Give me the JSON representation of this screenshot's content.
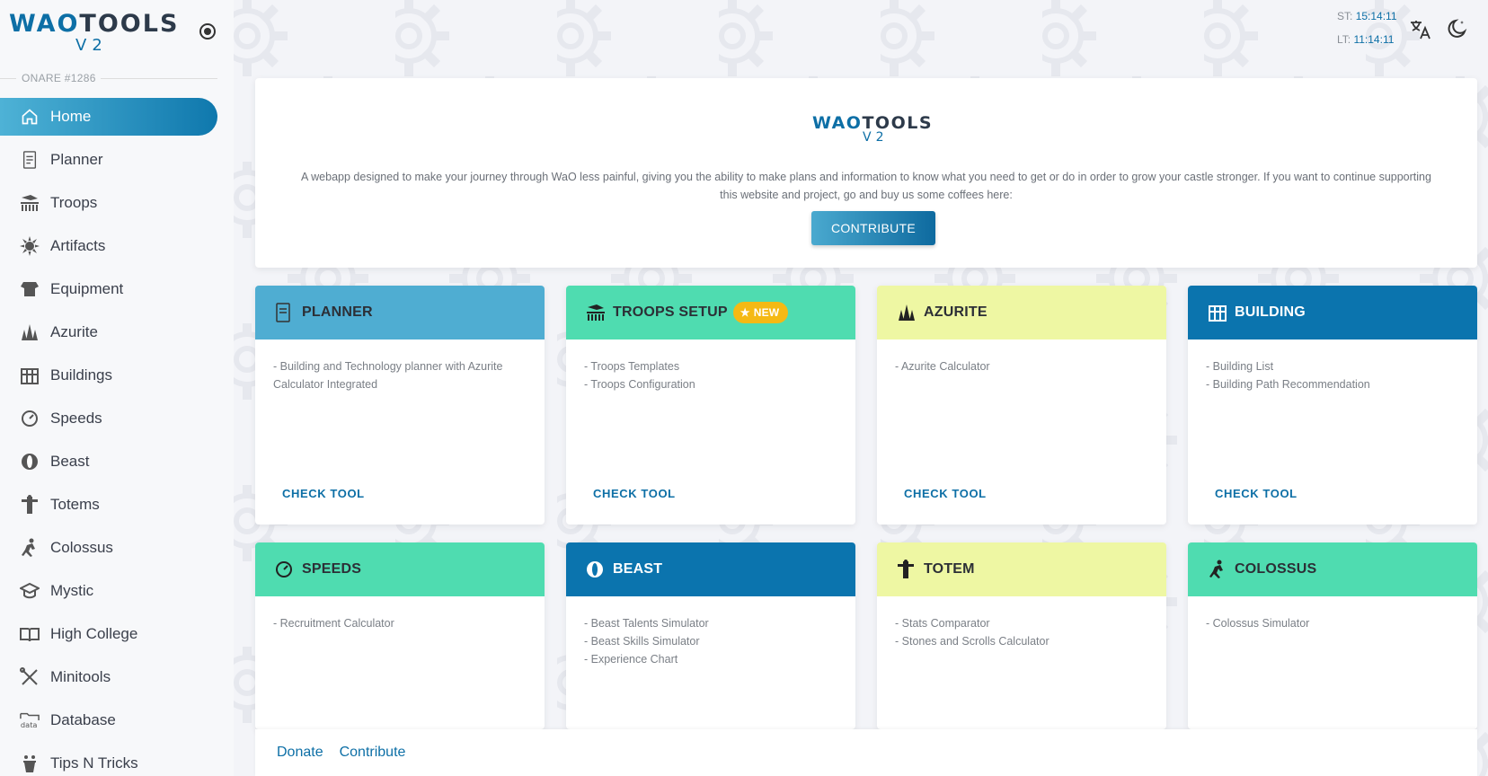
{
  "brand": {
    "logo_wao": "WAO",
    "logo_tools": "TOOLS",
    "logo_version": "V2"
  },
  "server": {
    "label": "ONARE #1286"
  },
  "sidebar": {
    "items": [
      {
        "label": "Home",
        "icon": "home-icon"
      },
      {
        "label": "Planner",
        "icon": "planner-icon"
      },
      {
        "label": "Troops",
        "icon": "troops-icon"
      },
      {
        "label": "Artifacts",
        "icon": "artifacts-icon"
      },
      {
        "label": "Equipment",
        "icon": "equipment-icon"
      },
      {
        "label": "Azurite",
        "icon": "azurite-icon"
      },
      {
        "label": "Buildings",
        "icon": "buildings-icon"
      },
      {
        "label": "Speeds",
        "icon": "speeds-icon"
      },
      {
        "label": "Beast",
        "icon": "beast-icon"
      },
      {
        "label": "Totems",
        "icon": "totems-icon"
      },
      {
        "label": "Colossus",
        "icon": "colossus-icon"
      },
      {
        "label": "Mystic",
        "icon": "mystic-icon"
      },
      {
        "label": "High College",
        "icon": "high-college-icon"
      },
      {
        "label": "Minitools",
        "icon": "minitools-icon"
      },
      {
        "label": "Database",
        "icon": "database-icon"
      },
      {
        "label": "Tips N Tricks",
        "icon": "tips-icon"
      }
    ]
  },
  "clock": {
    "st_label": "ST:",
    "st_value": "15:14:11",
    "lt_label": "LT:",
    "lt_value": "11:14:11"
  },
  "hero": {
    "description": "A webapp designed to make your journey through WaO less painful, giving you the ability to make plans and information to know what you need to get or do in order to grow your castle stronger. If you want to continue supporting this website and project, go and buy us some coffees here:",
    "button_label": "CONTRIBUTE"
  },
  "cards": [
    {
      "title": "PLANNER",
      "color": "#4fadd2",
      "lines": [
        "- Building and Technology planner with Azurite Calculator Integrated"
      ],
      "link": "CHECK TOOL"
    },
    {
      "title": "TROOPS SETUP",
      "color": "#4fdcb0",
      "badge": "NEW",
      "lines": [
        "- Troops Templates",
        "- Troops Configuration"
      ],
      "link": "CHECK TOOL"
    },
    {
      "title": "AZURITE",
      "color": "#eef7a3",
      "lines": [
        "- Azurite Calculator"
      ],
      "link": "CHECK TOOL"
    },
    {
      "title": "BUILDING",
      "color": "#0b74ae",
      "lines": [
        "- Building List",
        "- Building Path Recommendation"
      ],
      "link": "CHECK TOOL"
    },
    {
      "title": "SPEEDS",
      "color": "#4fdcb0",
      "lines": [
        "- Recruitment Calculator"
      ]
    },
    {
      "title": "BEAST",
      "color": "#0b74ae",
      "lines": [
        "- Beast Talents Simulator",
        "- Beast Skills Simulator",
        "- Experience Chart"
      ]
    },
    {
      "title": "TOTEM",
      "color": "#eef7a3",
      "lines": [
        "- Stats Comparator",
        "- Stones and Scrolls Calculator"
      ]
    },
    {
      "title": "COLOSSUS",
      "color": "#4fdcb0",
      "lines": [
        "- Colossus Simulator"
      ]
    }
  ],
  "footer": {
    "donate": "Donate",
    "contribute": "Contribute"
  }
}
